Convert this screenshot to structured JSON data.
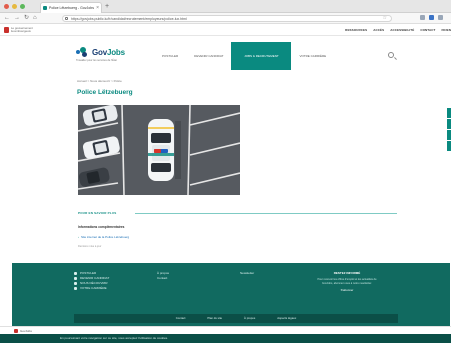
{
  "browser": {
    "tab_title": "Police Lëtzebuerg - GovJobs",
    "tab_close": "×",
    "new_tab": "+",
    "nav": {
      "back": "←",
      "forward": "→",
      "reload": "↻",
      "home": "⌂"
    },
    "url": "https://govjobs.public.lu/fr/candidat/recrutement/employeurs/police-lux.html",
    "star": "☆"
  },
  "gov_bar": {
    "name": "Le gouvernement luxembourgeois",
    "links": [
      "RESSOURCES",
      "ACCÈS",
      "ACCESSIBILITÉ",
      "CONTACT",
      "FR/EN"
    ]
  },
  "header": {
    "logo_text_1": "Gov",
    "logo_text_2": "Jobs",
    "tagline": "Travailler pour les services de l'État",
    "nav": [
      "POSTULER",
      "DEVENIR CANDIDAT",
      "JOBS & RECRUTEMENT",
      "VOTRE CARRIÈRE"
    ],
    "active_nav_index": 2
  },
  "breadcrumb": "Accueil > Nous découvrir > Police",
  "page_title": "Police Lëtzebuerg",
  "section": {
    "label": "POUR EN SAVOIR PLUS",
    "info_title": "Informations complémentaires",
    "link_text": "Site internet de la Police Lëtzebuerg",
    "link_arrow": "›",
    "meta": "Dernière mise à jour"
  },
  "footer": {
    "col1": [
      "POSTULER",
      "DEVENIR CANDIDAT",
      "NOUS DÉCOUVRIR",
      "VOTRE CARRIÈRE"
    ],
    "col2": [
      "À propos",
      "Contact"
    ],
    "col3": [
      "Newsletter"
    ],
    "col4": {
      "title": "RESTEZ INFORMÉ",
      "desc": "Pour recevoir les offres d'emploi et les actualités de GovJobs, abonnez-vous à notre newsletter.",
      "button": "S'abonner"
    },
    "bottom_links": [
      "Contact",
      "Plan du site",
      "À propos",
      "Aspects légaux"
    ]
  },
  "footer_strip": {
    "name": "GovJobs"
  },
  "cookie_bar": "En poursuivant votre navigation sur ce site, vous acceptez l'utilisation de cookies.",
  "colors": {
    "accent": "#0a8a80",
    "footer": "#116a60",
    "footer_dark": "#0b4f47",
    "title_blue": "#1a3f73"
  }
}
